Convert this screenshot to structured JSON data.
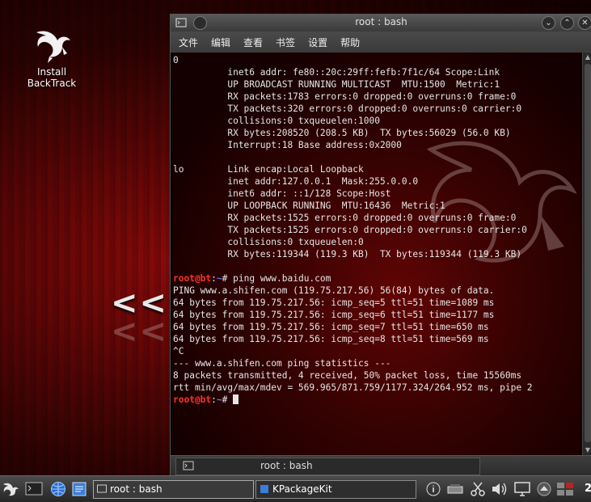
{
  "desktop": {
    "icon_label_line1": "Install",
    "icon_label_line2": "BackTrack",
    "watermark_text": "<<"
  },
  "window": {
    "title": "root : bash",
    "menu": [
      "文件",
      "编辑",
      "查看",
      "书签",
      "设置",
      "帮助"
    ],
    "tab_label": "root : bash"
  },
  "terminal": {
    "lines_before": [
      "0",
      "          inet6 addr: fe80::20c:29ff:fefb:7f1c/64 Scope:Link",
      "          UP BROADCAST RUNNING MULTICAST  MTU:1500  Metric:1",
      "          RX packets:1783 errors:0 dropped:0 overruns:0 frame:0",
      "          TX packets:320 errors:0 dropped:0 overruns:0 carrier:0",
      "          collisions:0 txqueuelen:1000",
      "          RX bytes:208520 (208.5 KB)  TX bytes:56029 (56.0 KB)",
      "          Interrupt:18 Base address:0x2000",
      "",
      "lo        Link encap:Local Loopback",
      "          inet addr:127.0.0.1  Mask:255.0.0.0",
      "          inet6 addr: ::1/128 Scope:Host",
      "          UP LOOPBACK RUNNING  MTU:16436  Metric:1",
      "          RX packets:1525 errors:0 dropped:0 overruns:0 frame:0",
      "          TX packets:1525 errors:0 dropped:0 overruns:0 carrier:0",
      "          collisions:0 txqueuelen:0",
      "          RX bytes:119344 (119.3 KB)  TX bytes:119344 (119.3 KB)",
      ""
    ],
    "prompt_user": "root@bt",
    "prompt_sep": ":",
    "prompt_path": "~",
    "prompt_end": "# ",
    "command": "ping www.baidu.com",
    "output_lines": [
      "PING www.a.shifen.com (119.75.217.56) 56(84) bytes of data.",
      "64 bytes from 119.75.217.56: icmp_seq=5 ttl=51 time=1089 ms",
      "64 bytes from 119.75.217.56: icmp_seq=6 ttl=51 time=1177 ms",
      "64 bytes from 119.75.217.56: icmp_seq=7 ttl=51 time=650 ms",
      "64 bytes from 119.75.217.56: icmp_seq=8 ttl=51 time=569 ms",
      "^C",
      "--- www.a.shifen.com ping statistics ---",
      "8 packets transmitted, 4 received, 50% packet loss, time 15560ms",
      "rtt min/avg/max/mdev = 569.965/871.759/1177.324/264.952 ms, pipe 2"
    ]
  },
  "taskbar": {
    "tasks": [
      "root : bash",
      "KPackageKit"
    ],
    "clock": "2"
  },
  "colors": {
    "prompt_user": "#ff3030",
    "prompt_path": "#6a6aff",
    "terminal_text": "#e6e6e6"
  }
}
